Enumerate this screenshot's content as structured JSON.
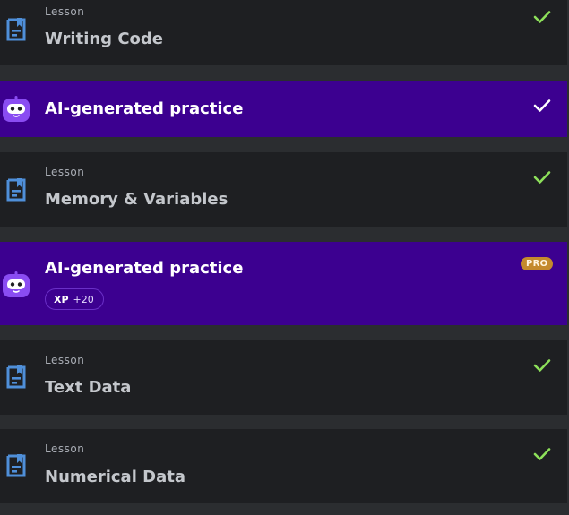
{
  "items": [
    {
      "type": "lesson",
      "kind": "Lesson",
      "title": "Writing Code",
      "completed": true
    },
    {
      "type": "practice",
      "title": "AI-generated practice",
      "completed": true
    },
    {
      "type": "lesson",
      "kind": "Lesson",
      "title": "Memory & Variables",
      "completed": true
    },
    {
      "type": "practice",
      "title": "AI-generated practice",
      "badge": "PRO",
      "xp_label": "XP",
      "xp_value": "+20",
      "completed": false
    },
    {
      "type": "lesson",
      "kind": "Lesson",
      "title": "Text Data",
      "completed": true
    },
    {
      "type": "lesson",
      "kind": "Lesson",
      "title": "Numerical Data",
      "completed": true
    }
  ],
  "colors": {
    "lesson_bg": "#1e1f22",
    "practice_bg": "#3c0090",
    "check_green": "#8de05a",
    "check_white": "#ffffff",
    "lesson_icon": "#4f8fd9",
    "pro_badge": "#c48a2c"
  },
  "icons": {
    "lesson": "document-bookmark-icon",
    "practice": "ai-bot-icon",
    "done": "checkmark-icon"
  }
}
